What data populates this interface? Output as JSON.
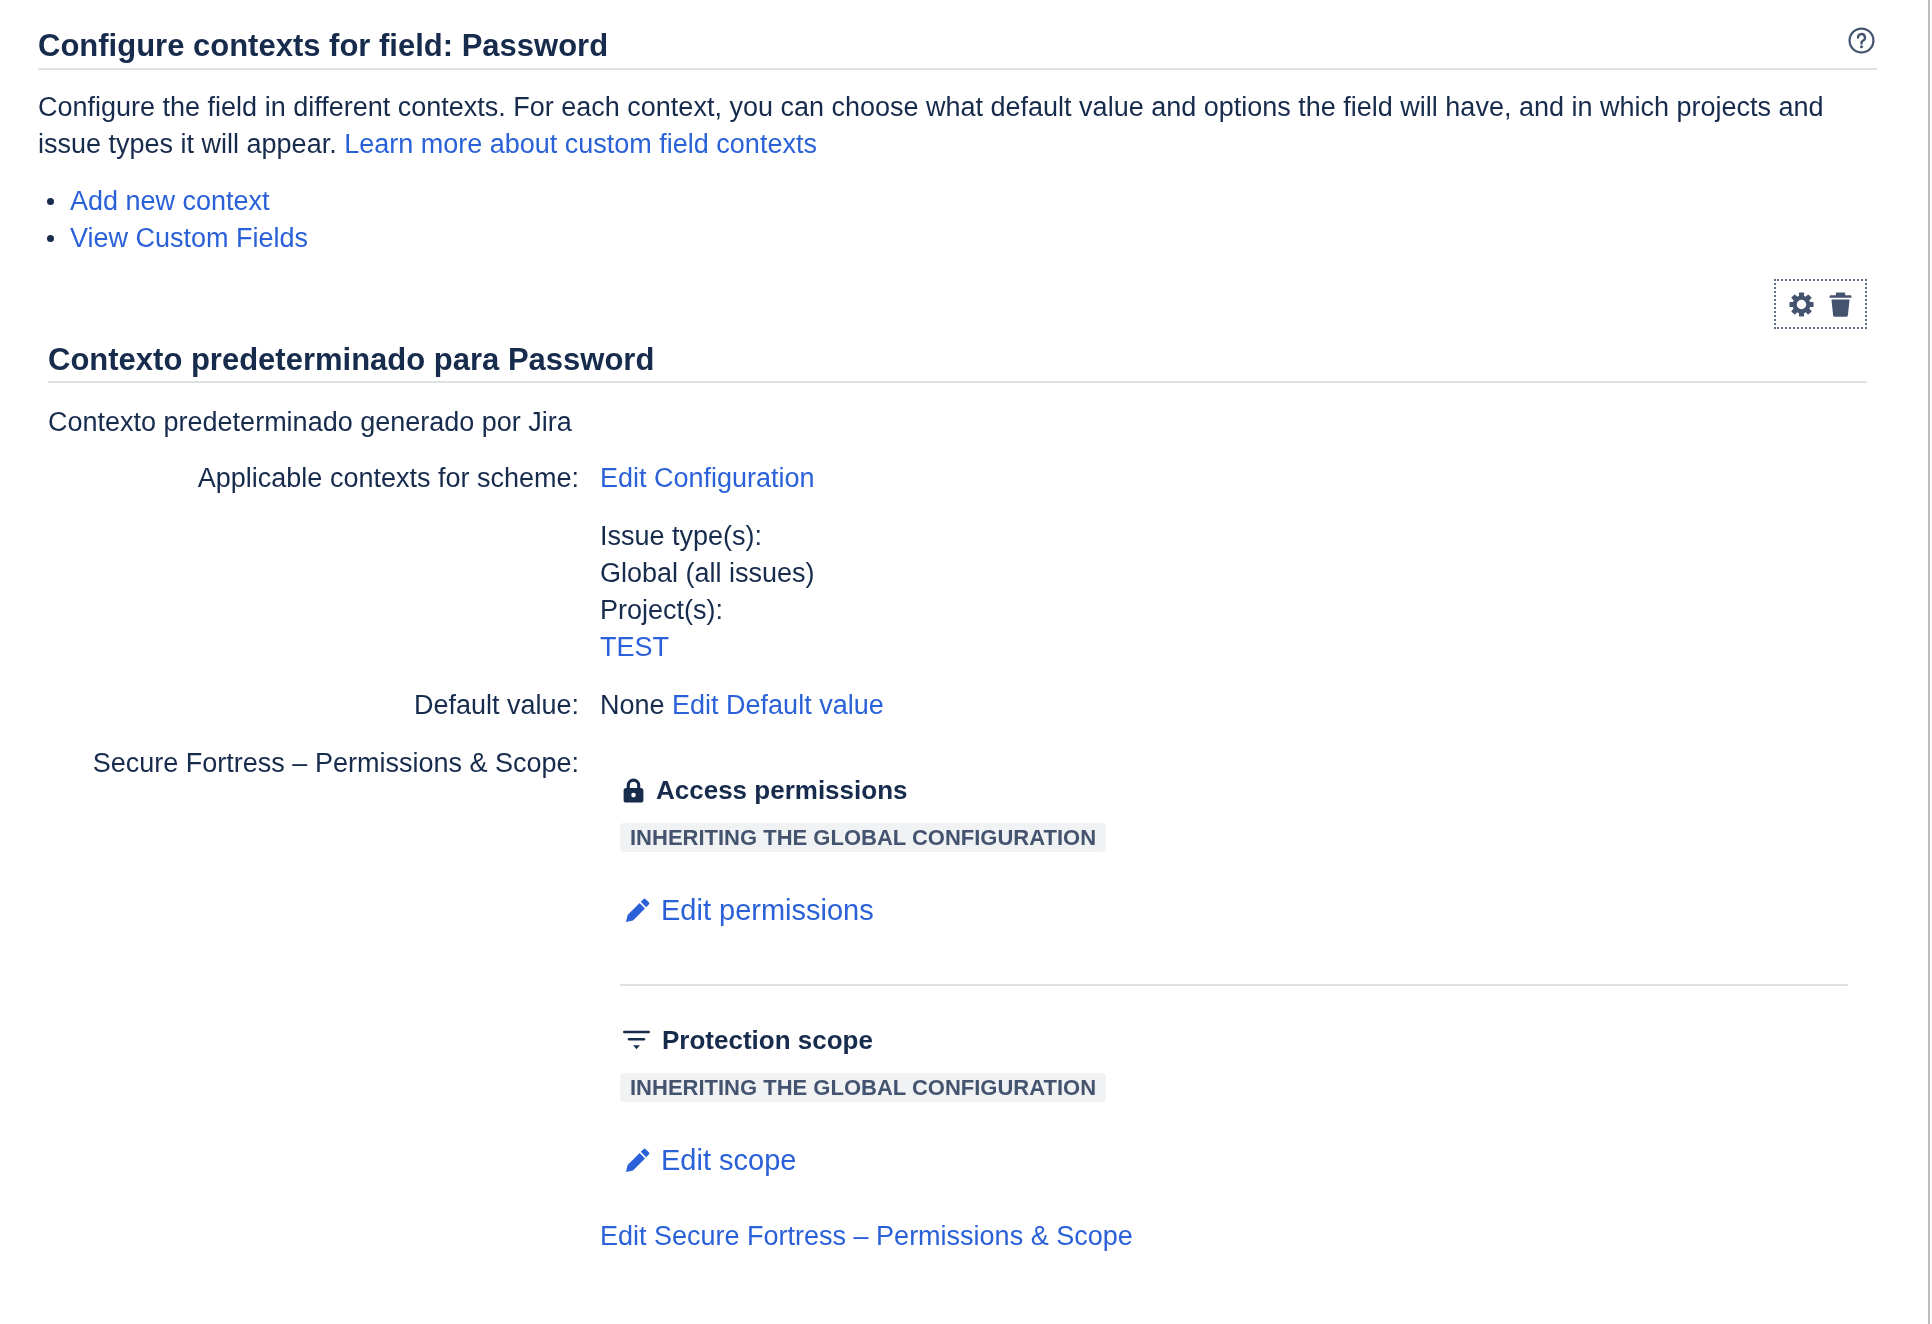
{
  "title": "Configure contexts for field: Password",
  "intro": {
    "text": "Configure the field in different contexts. For each context, you can choose what default value and options the field will have, and in which projects and issue types it will appear.",
    "link": "Learn more about custom field contexts"
  },
  "links": [
    "Add new context",
    "View Custom Fields"
  ],
  "context": {
    "title": "Contexto predeterminado para Password",
    "description": "Contexto predeterminado generado por Jira",
    "fields": [
      {
        "kind": "scheme",
        "label": "Applicable contexts for scheme:",
        "link": "Edit Configuration",
        "details": [
          {
            "kind": "text",
            "text": "Issue type(s):"
          },
          {
            "kind": "text",
            "text": "Global (all issues)"
          },
          {
            "kind": "text",
            "text": "Project(s):"
          },
          {
            "kind": "link",
            "text": "TEST"
          }
        ]
      },
      {
        "kind": "default",
        "label": "Default value:",
        "value": "None",
        "link": "Edit Default value"
      },
      {
        "kind": "app",
        "label": "Secure Fortress – Permissions & Scope:",
        "sections": [
          {
            "kind": "permissions",
            "title": "Access permissions",
            "status": "INHERITING THE GLOBAL CONFIGURATION",
            "link": "Edit permissions"
          },
          {
            "kind": "scope",
            "title": "Protection scope",
            "status": "INHERITING THE GLOBAL CONFIGURATION",
            "link": "Edit scope"
          }
        ],
        "link": "Edit Secure Fortress – Permissions & Scope"
      }
    ]
  }
}
